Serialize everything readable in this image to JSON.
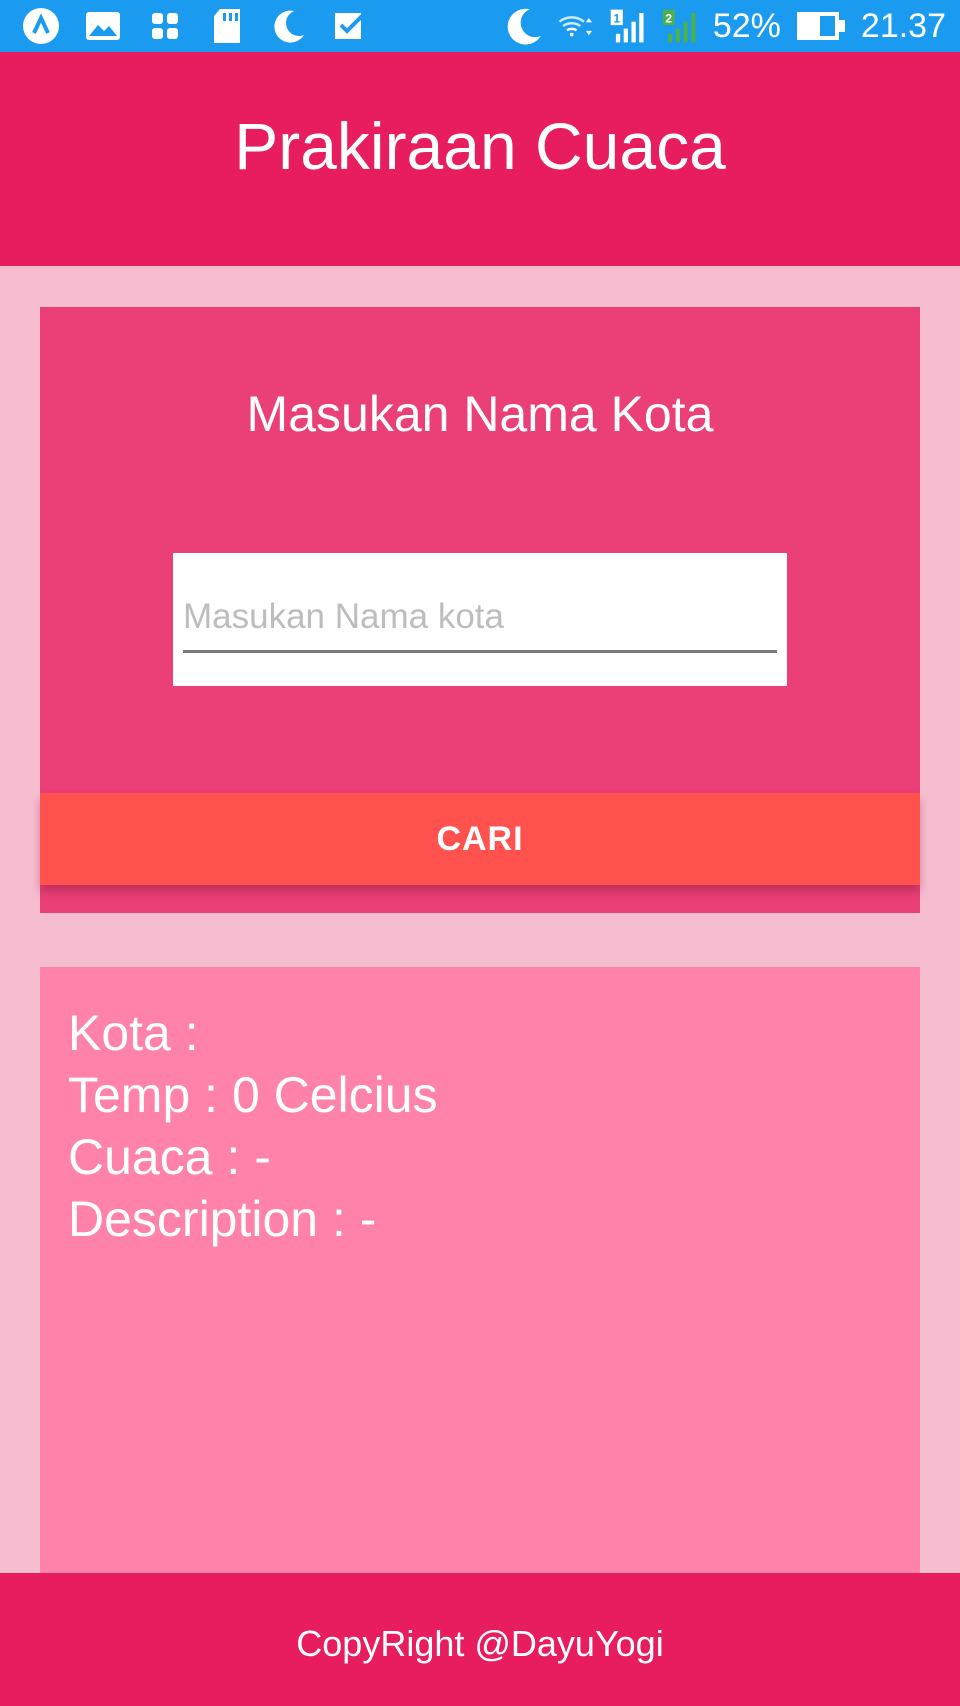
{
  "status_bar": {
    "icons_left": [
      "app-a-icon",
      "gallery-icon",
      "grid-icon",
      "sd-card-icon",
      "moon-icon",
      "checkbox-icon"
    ],
    "icons_right": [
      "moon-icon",
      "wifi-icon",
      "signal-sim1-icon",
      "signal-sim2-icon",
      "battery-icon"
    ],
    "battery": "52%",
    "time": "21.37"
  },
  "app_bar": {
    "title": "Prakiraan Cuaca"
  },
  "search": {
    "heading": "Masukan Nama Kota",
    "input_value": "",
    "input_placeholder": "Masukan Nama kota",
    "button_label": "CARI"
  },
  "result": {
    "kota": "Kota :",
    "temp": "Temp : 0 Celcius",
    "cuaca": "Cuaca : -",
    "description": "Description : -"
  },
  "footer": {
    "text": "CopyRight @DayuYogi"
  },
  "colors": {
    "status_bar": "#1a9bf0",
    "primary": "#e71d5f",
    "background": "#f6bdd1",
    "search_card": "#ea3f77",
    "button": "#ff524f",
    "result_card": "#ff82aa"
  }
}
